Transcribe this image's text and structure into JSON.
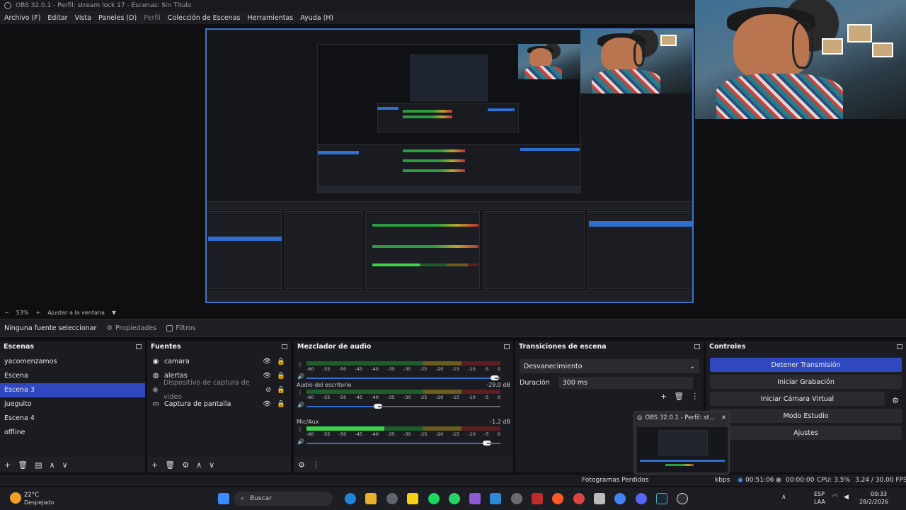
{
  "window": {
    "title": "OBS 32.0.1 - Perfil: stream lock 17 - Escenas: Sin Título"
  },
  "menu": [
    "Archivo (F)",
    "Editar",
    "Vista",
    "Paneles (D)",
    "Perfil",
    "Colección de Escenas",
    "Herramientas",
    "Ayuda (H)"
  ],
  "zoom": {
    "minus": "−",
    "value": "53%",
    "plus": "+",
    "fit_label": "Ajustar a la ventana"
  },
  "source_toolbar": {
    "selection": "Ninguna fuente seleccionar",
    "properties": "Propiedades",
    "filters": "Filtros"
  },
  "scenes": {
    "title": "Escenas",
    "items": [
      {
        "label": "yacomenzamos",
        "selected": false
      },
      {
        "label": "Escena",
        "selected": false
      },
      {
        "label": "Escena 3",
        "selected": true
      },
      {
        "label": "jueguito",
        "selected": false
      },
      {
        "label": "Escena 4",
        "selected": false
      },
      {
        "label": "offline",
        "selected": false
      }
    ]
  },
  "sources": {
    "title": "Fuentes",
    "items": [
      {
        "label": "camara",
        "icon": "camera-icon",
        "dim": false
      },
      {
        "label": "alertas",
        "icon": "globe-icon",
        "dim": false
      },
      {
        "label": "Dispositivo de captura de video",
        "icon": "camera-icon",
        "dim": true
      },
      {
        "label": "Captura de pantalla",
        "icon": "monitor-icon",
        "dim": false
      }
    ]
  },
  "mixer": {
    "title": "Mezclador de audio",
    "ticks": [
      "-60",
      "-55",
      "-50",
      "-45",
      "-40",
      "-35",
      "-30",
      "-25",
      "-20",
      "-15",
      "-10",
      "-5",
      "0"
    ],
    "channels": [
      {
        "name": "",
        "db": "",
        "level": 0.0,
        "volume": 0.97
      },
      {
        "name": "Audio del escritorio",
        "db": "-29.0 dB",
        "level": 0.0,
        "volume": 0.37
      },
      {
        "name": "Mic/Aux",
        "db": "-1.2 dB",
        "level": 0.4,
        "volume": 0.93
      }
    ]
  },
  "transitions": {
    "title": "Transiciones de escena",
    "type": "Desvanecimiento",
    "duration_label": "Duración",
    "duration_value": "300 ms"
  },
  "controls": {
    "title": "Controles",
    "buttons": [
      {
        "label": "Detener Transmisión",
        "active": true
      },
      {
        "label": "Iniciar Grabación",
        "active": false
      },
      {
        "label": "Iniciar Cámara Virtual",
        "active": false
      },
      {
        "label": "Modo Estudio",
        "active": false
      },
      {
        "label": "Ajustes",
        "active": false
      }
    ]
  },
  "status": {
    "dropped": "Fotogramas Perdidos",
    "bitrate": "kbps",
    "stream_time": "00:51:06",
    "rec_time": "00:00:00",
    "cpu": "CPU: 3.5%",
    "fps": "3.24 / 30.00 FPS"
  },
  "popup": {
    "title": "OBS 32.0.1 - Perfil: st..."
  },
  "taskbar": {
    "weather_temp": "22°C",
    "weather_desc": "Despejado",
    "search": "Buscar",
    "lang": "ESP",
    "lang2": "LAA",
    "time": "00:33",
    "date": "28/2/2026"
  }
}
